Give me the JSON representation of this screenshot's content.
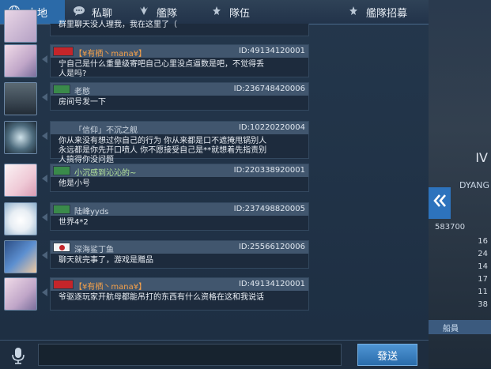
{
  "tabs": [
    {
      "label": "本地",
      "icon": "globe-icon",
      "active": true
    },
    {
      "label": "私聊",
      "icon": "chat-bubble-icon",
      "active": false
    },
    {
      "label": "艦隊",
      "icon": "fleet-icon",
      "active": false
    },
    {
      "label": "隊伍",
      "icon": "team-icon",
      "active": false
    },
    {
      "label": "艦隊招募",
      "icon": "recruit-icon",
      "active": false
    }
  ],
  "partial_message": {
    "text": "群里聊天没人理我，我在这里了（"
  },
  "messages": [
    {
      "name": "【¥有栖丶mana¥】",
      "id": "ID:49134120001",
      "text": "宁自己是什么重量级寄吧自己心里没点逼数是吧，不觉得丢\n人是吗?",
      "name_color": "orange",
      "flag": "red"
    },
    {
      "name": "老憨",
      "id": "ID:236748420006",
      "text": "房间号发一下",
      "name_color": "gray",
      "flag": "green"
    },
    {
      "name": "「信仰」不沉之舰",
      "id": "ID:10220220004",
      "text": "你从来没有想过你自己的行为 你从来都是口不遮掩甩锅别人\n永远都是你先开口喷人 你不愿接受自己是**就想着先指责别\n人搞得你没问题",
      "name_color": "gray",
      "flag": "none"
    },
    {
      "name": "小沉感到沁沁的~",
      "id": "ID:220338920001",
      "text": "他是小号",
      "name_color": "green",
      "flag": "green"
    },
    {
      "name": "陆峰yyds",
      "id": "ID:237498820005",
      "text": "世界4*2",
      "name_color": "gray",
      "flag": "green"
    },
    {
      "name": "深海鲨丁鱼",
      "id": "ID:25566120006",
      "text": "聊天就完事了，游戏是赠品",
      "name_color": "gray",
      "flag": "japan"
    },
    {
      "name": "【¥有栖丶mana¥】",
      "id": "ID:49134120001",
      "text": "爷驱逐玩家开航母都能吊打的东西有什么资格在这和我说话",
      "name_color": "orange",
      "flag": "red"
    }
  ],
  "input": {
    "placeholder": "",
    "send_label": "發送"
  },
  "background_right": {
    "roman": "IV",
    "label": "DYANG",
    "number": "583700",
    "stats": [
      "16",
      "24",
      "14",
      "17",
      "11",
      "38"
    ],
    "bar_label": "船員"
  },
  "colors": {
    "active_tab": "#2b6aa8",
    "send_button": "#3c82c4",
    "orange_name": "#f4a04a",
    "green_name": "#b8e89c"
  }
}
